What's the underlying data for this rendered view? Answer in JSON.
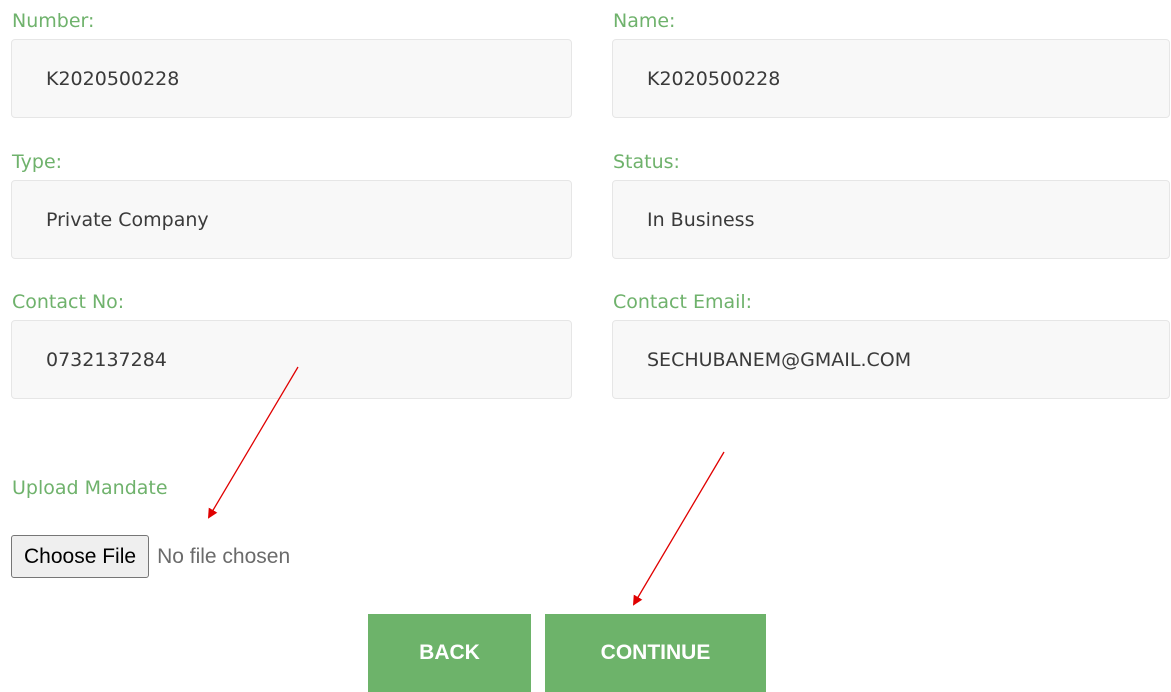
{
  "form": {
    "number": {
      "label": "Number:",
      "value": "K2020500228"
    },
    "name": {
      "label": "Name:",
      "value": "K2020500228"
    },
    "type": {
      "label": "Type:",
      "value": "Private Company"
    },
    "status": {
      "label": "Status:",
      "value": "In Business"
    },
    "contact_no": {
      "label": "Contact No:",
      "value": "0732137284"
    },
    "contact_email": {
      "label": "Contact Email:",
      "value": "SECHUBANEM@GMAIL.COM"
    }
  },
  "upload": {
    "label": "Upload Mandate",
    "button_label": "Choose File",
    "status_text": "No file chosen"
  },
  "actions": {
    "back_label": "BACK",
    "continue_label": "CONTINUE"
  },
  "colors": {
    "label_green": "#6fb26c",
    "button_green": "#6db36a",
    "annotation_red": "#e00000"
  }
}
